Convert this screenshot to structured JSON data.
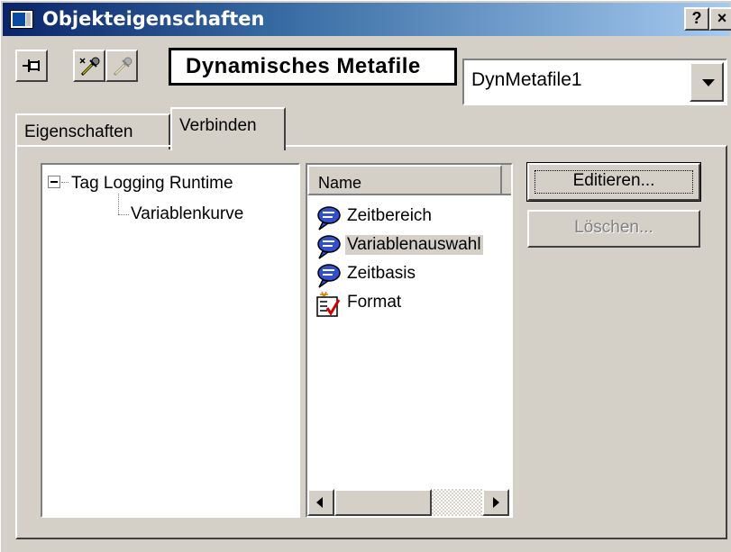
{
  "window": {
    "title": "Objekteigenschaften",
    "help_label": "?",
    "close_label": "×",
    "title_bar_color": "#0a246a"
  },
  "toolbar": {
    "pin_icon": "pin-icon",
    "picker_icon": "eyedropper-icon",
    "picker_disabled_icon": "eyedropper-disabled-icon",
    "object_type": "Dynamisches Metafile",
    "object_name": "DynMetafile1"
  },
  "tabs": [
    {
      "label": "Eigenschaften",
      "active": false
    },
    {
      "label": "Verbinden",
      "active": true
    }
  ],
  "tree": {
    "root": "Tag Logging Runtime",
    "child": "Variablenkurve"
  },
  "list": {
    "header": "Name",
    "items": [
      {
        "label": "Zeitbereich",
        "icon": "dynamic-dialog-icon",
        "selected": false
      },
      {
        "label": "Variablenauswahl",
        "icon": "dynamic-dialog-icon",
        "selected": true
      },
      {
        "label": "Zeitbasis",
        "icon": "dynamic-dialog-icon",
        "selected": false
      },
      {
        "label": "Format",
        "icon": "format-checklist-icon",
        "selected": false
      }
    ]
  },
  "buttons": {
    "edit": "Editieren...",
    "delete": "Löschen..."
  }
}
